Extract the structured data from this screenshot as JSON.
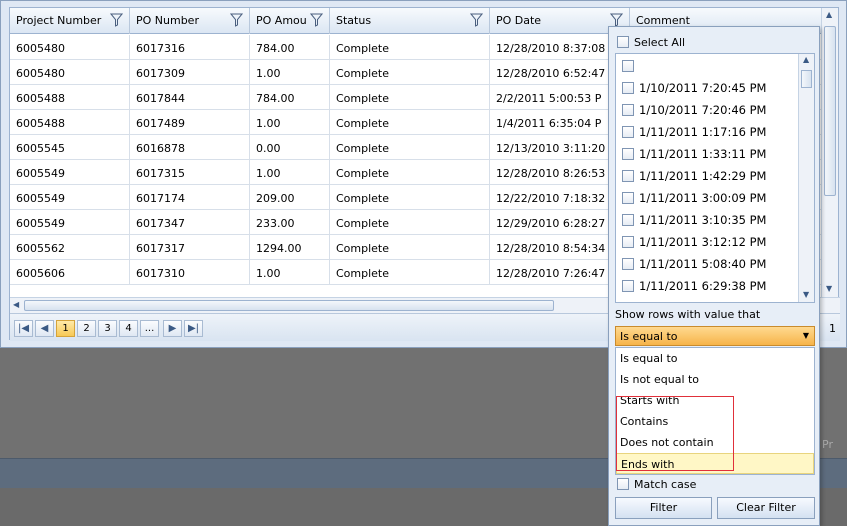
{
  "columns": [
    {
      "label": "Project Number",
      "has_filter": true
    },
    {
      "label": "PO Number",
      "has_filter": true
    },
    {
      "label": "PO Amou",
      "has_filter": true
    },
    {
      "label": "Status",
      "has_filter": true
    },
    {
      "label": "PO Date",
      "has_filter": true
    },
    {
      "label": "Comment",
      "has_filter": false
    }
  ],
  "rows": [
    [
      "6005480",
      "6017316",
      "784.00",
      "Complete",
      "12/28/2010 8:37:08",
      ""
    ],
    [
      "6005480",
      "6017309",
      "1.00",
      "Complete",
      "12/28/2010 6:52:47",
      ""
    ],
    [
      "6005488",
      "6017844",
      "784.00",
      "Complete",
      "2/2/2011 5:00:53 P",
      ""
    ],
    [
      "6005488",
      "6017489",
      "1.00",
      "Complete",
      "1/4/2011 6:35:04 P",
      ""
    ],
    [
      "6005545",
      "6016878",
      "0.00",
      "Complete",
      "12/13/2010 3:11:20",
      ""
    ],
    [
      "6005549",
      "6017315",
      "1.00",
      "Complete",
      "12/28/2010 8:26:53",
      ""
    ],
    [
      "6005549",
      "6017174",
      "209.00",
      "Complete",
      "12/22/2010 7:18:32",
      ""
    ],
    [
      "6005549",
      "6017347",
      "233.00",
      "Complete",
      "12/29/2010 6:28:27",
      ""
    ],
    [
      "6005562",
      "6017317",
      "1294.00",
      "Complete",
      "12/28/2010 8:54:34",
      ""
    ],
    [
      "6005606",
      "6017310",
      "1.00",
      "Complete",
      "12/28/2010 7:26:47",
      ""
    ]
  ],
  "pager": {
    "pages": [
      "1",
      "2",
      "3",
      "4",
      "..."
    ],
    "active_page": "1",
    "right_text": "1"
  },
  "filter": {
    "select_all_label": "Select All",
    "values": [
      "",
      "1/10/2011 7:20:45 PM",
      "1/10/2011 7:20:46 PM",
      "1/11/2011 1:17:16 PM",
      "1/11/2011 1:33:11 PM",
      "1/11/2011 1:42:29 PM",
      "1/11/2011 3:00:09 PM",
      "1/11/2011 3:10:35 PM",
      "1/11/2011 3:12:12 PM",
      "1/11/2011 5:08:40 PM",
      "1/11/2011 6:29:38 PM"
    ],
    "show_rows_label": "Show rows with value that",
    "selected_operator": "Is equal to",
    "operators": [
      "Is equal to",
      "Is not equal to",
      "Starts with",
      "Contains",
      "Does not contain",
      "Ends with"
    ],
    "highlighted_operator": "Ends with",
    "match_case_label": "Match case",
    "filter_button": "Filter",
    "clear_button": "Clear Filter"
  },
  "background": {
    "partial_text": "Pr"
  },
  "colors": {
    "selected_orange": "#f6b44a",
    "highlight_yellow": "#fff7c6",
    "annotation_red": "#e0303a"
  }
}
